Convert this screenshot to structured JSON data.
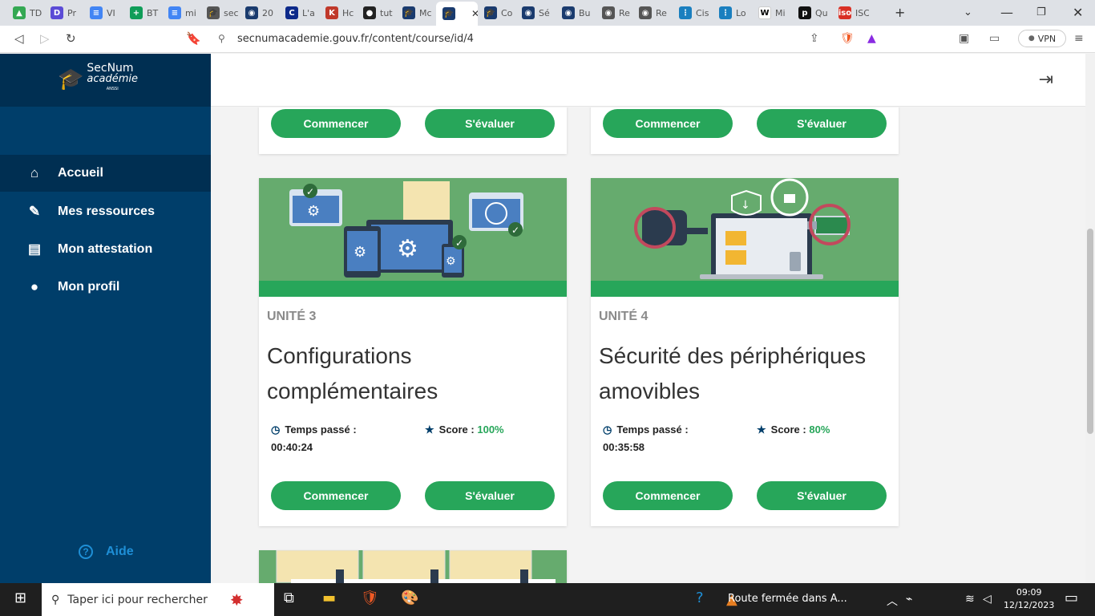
{
  "browser": {
    "tabs": [
      {
        "label": "TD",
        "color": "#34a853",
        "glyph": "▲"
      },
      {
        "label": "Pr",
        "color": "#5b4bd6",
        "glyph": "D"
      },
      {
        "label": "VI",
        "color": "#4285f4",
        "glyph": "≡"
      },
      {
        "label": "BT",
        "color": "#0f9d58",
        "glyph": "+"
      },
      {
        "label": "mi",
        "color": "#4285f4",
        "glyph": "≡"
      },
      {
        "label": "sec",
        "color": "#555555",
        "glyph": "🎓"
      },
      {
        "label": "20",
        "color": "#1a3b6e",
        "glyph": "◉"
      },
      {
        "label": "L'a",
        "color": "#0d2a8a",
        "glyph": "C"
      },
      {
        "label": "Hc",
        "color": "#c0392b",
        "glyph": "K"
      },
      {
        "label": "tut",
        "color": "#222222",
        "glyph": "●"
      },
      {
        "label": "Mc",
        "color": "#1a3b6e",
        "glyph": "🎓"
      },
      {
        "label": "",
        "color": "#1a3b6e",
        "glyph": "🎓"
      },
      {
        "label": "Co",
        "color": "#1a3b6e",
        "glyph": "🎓"
      },
      {
        "label": "Sé",
        "color": "#1a3b6e",
        "glyph": "◉"
      },
      {
        "label": "Bu",
        "color": "#1a3b6e",
        "glyph": "◉"
      },
      {
        "label": "Re",
        "color": "#555555",
        "glyph": "◉"
      },
      {
        "label": "Re",
        "color": "#555555",
        "glyph": "◉"
      },
      {
        "label": "Cis",
        "color": "#1a7fbf",
        "glyph": "⋮"
      },
      {
        "label": "Lo",
        "color": "#1a7fbf",
        "glyph": "⋮"
      },
      {
        "label": "Mi",
        "color": "#ffffff",
        "glyph": "W"
      },
      {
        "label": "Qu",
        "color": "#111111",
        "glyph": "p"
      },
      {
        "label": "ISC",
        "color": "#d93025",
        "glyph": "iso"
      }
    ],
    "url": "secnumacademie.gouv.fr/content/course/id/4",
    "vpn_label": "VPN"
  },
  "logo": {
    "line1": "SecNum",
    "line2": "académie",
    "line3": "ANSSI"
  },
  "sidebar": {
    "items": [
      {
        "label": "Accueil",
        "icon": "home-icon"
      },
      {
        "label": "Mes ressources",
        "icon": "paperclip-icon"
      },
      {
        "label": "Mon attestation",
        "icon": "document-icon"
      },
      {
        "label": "Mon profil",
        "icon": "user-icon"
      }
    ],
    "help_label": "Aide"
  },
  "cards_top": {
    "start_label": "Commencer",
    "eval_label": "S'évaluer"
  },
  "cards": [
    {
      "unit": "UNITÉ 3",
      "title": "Configurations complémentaires",
      "time_label": "Temps passé :",
      "time_value": "00:40:24",
      "score_label": "Score :",
      "score_value": "100%",
      "start_label": "Commencer",
      "eval_label": "S'évaluer"
    },
    {
      "unit": "UNITÉ 4",
      "title": "Sécurité des périphériques amovibles",
      "time_label": "Temps passé :",
      "time_value": "00:35:58",
      "score_label": "Score :",
      "score_value": "80%",
      "start_label": "Commencer",
      "eval_label": "S'évaluer"
    }
  ],
  "taskbar": {
    "search_placeholder": "Taper ici pour rechercher",
    "news": "Route fermée dans A...",
    "time": "09:09",
    "date": "12/12/2023"
  }
}
